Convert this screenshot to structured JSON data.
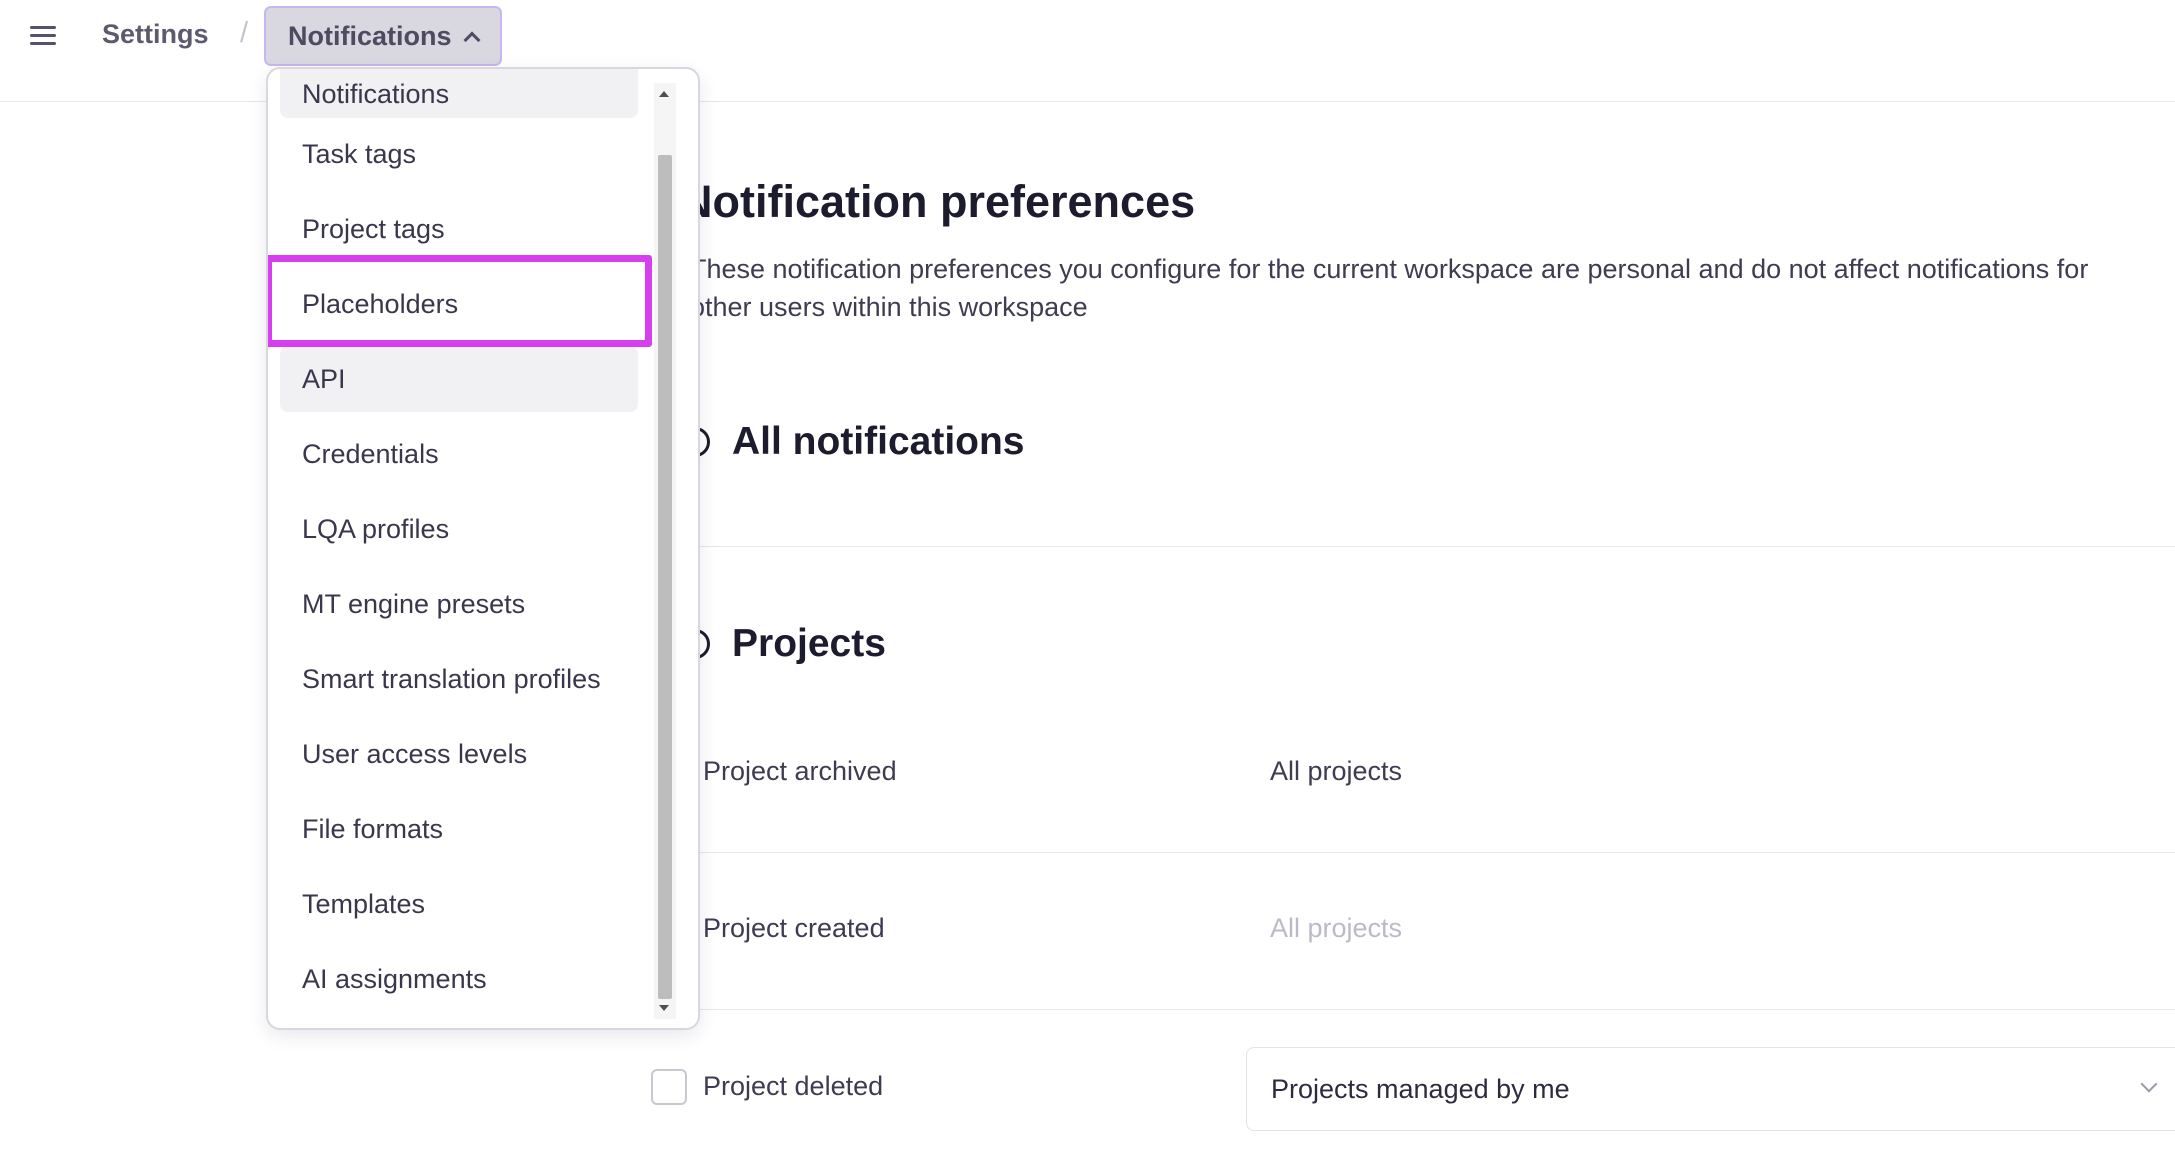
{
  "breadcrumb": {
    "root": "Settings",
    "separator": "/",
    "current": "Notifications"
  },
  "menu": {
    "items": [
      "Notifications",
      "Task tags",
      "Project tags",
      "Placeholders",
      "API",
      "Credentials",
      "LQA profiles",
      "MT engine presets",
      "Smart translation profiles",
      "User access levels",
      "File formats",
      "Templates",
      "AI assignments"
    ],
    "highlighted": "Placeholders",
    "highlight_color": "#d63ef0"
  },
  "page": {
    "title": "Notification preferences",
    "description": "These notification preferences you configure for the current workspace are personal and do not affect notifications for other users within this workspace"
  },
  "sections": {
    "all": {
      "title": "All notifications"
    },
    "projects": {
      "title": "Projects",
      "rows": [
        {
          "label": "Project archived",
          "value": "All projects"
        },
        {
          "label": "Project created",
          "value": "All projects"
        },
        {
          "label": "Project deleted",
          "value": "Projects managed by me"
        }
      ]
    }
  }
}
